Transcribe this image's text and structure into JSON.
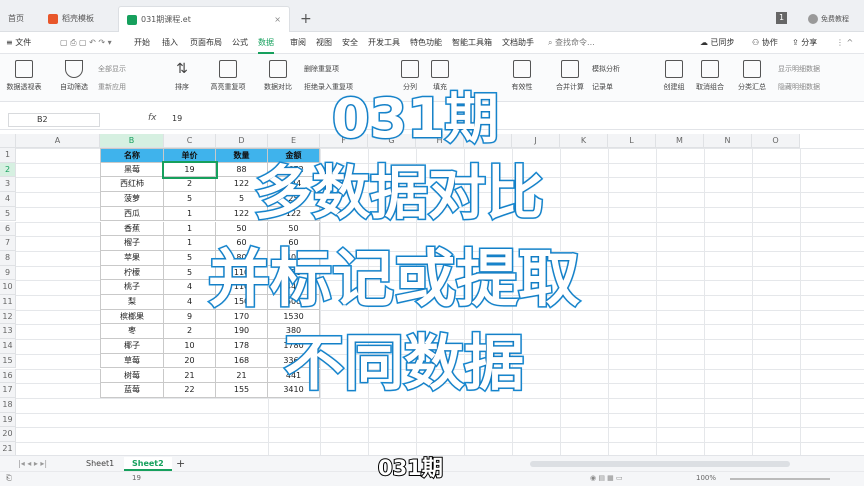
{
  "tabs": [
    {
      "label": "首页"
    },
    {
      "label": "稻壳模板"
    },
    {
      "label": "031期课程.et"
    }
  ],
  "new_tab": "+",
  "window_badge": "1",
  "user": "免费教程",
  "menu": [
    "文件",
    "开始",
    "插入",
    "页面布局",
    "公式",
    "数据",
    "审阅",
    "视图",
    "安全",
    "开发工具",
    "特色功能",
    "智能工具箱",
    "文档助手",
    "查找命令...",
    "已同步",
    "协作",
    "分享"
  ],
  "ribbon": {
    "buttons": [
      "数据透视表",
      "自动筛选",
      "排序",
      "高亮重复项",
      "数据对比",
      "分列",
      "填充",
      "有效性",
      "合并计算",
      "模拟分析",
      "记录单",
      "创建组",
      "取消组合",
      "分类汇总"
    ],
    "small": [
      "全部显示",
      "重新应用",
      "删除重复项",
      "拒绝录入重复项",
      "显示明细数据",
      "隐藏明细数据"
    ]
  },
  "formula_bar": {
    "cell_ref": "B2",
    "fx": "fx",
    "value": "19"
  },
  "columns": [
    "A",
    "B",
    "C",
    "D",
    "E",
    "F",
    "G",
    "H",
    "I",
    "J",
    "K",
    "L",
    "M",
    "N",
    "O"
  ],
  "table": {
    "headers": [
      "名称",
      "单价",
      "数量",
      "金额"
    ],
    "rows": [
      [
        "黑莓",
        "19",
        "88",
        "1672"
      ],
      [
        "西红柿",
        "2",
        "122",
        "244"
      ],
      [
        "菠萝",
        "5",
        "5",
        "25"
      ],
      [
        "西瓜",
        "1",
        "122",
        "122"
      ],
      [
        "香蕉",
        "1",
        "50",
        "50"
      ],
      [
        "榴子",
        "1",
        "60",
        "60"
      ],
      [
        "苹果",
        "5",
        "80",
        "400"
      ],
      [
        "柠檬",
        "5",
        "110",
        "550"
      ],
      [
        "桃子",
        "4",
        "110",
        "440"
      ],
      [
        "梨",
        "4",
        "150",
        "600"
      ],
      [
        "槟榔果",
        "9",
        "170",
        "1530"
      ],
      [
        "枣",
        "2",
        "190",
        "380"
      ],
      [
        "椰子",
        "10",
        "178",
        "1780"
      ],
      [
        "草莓",
        "20",
        "168",
        "3360"
      ],
      [
        "树莓",
        "21",
        "21",
        "441"
      ],
      [
        "蓝莓",
        "22",
        "155",
        "3410"
      ]
    ]
  },
  "row_numbers": [
    "1",
    "2",
    "3",
    "4",
    "5",
    "6",
    "7",
    "8",
    "9",
    "10",
    "11",
    "12",
    "13",
    "14",
    "15",
    "16",
    "17",
    "18",
    "19",
    "20",
    "21"
  ],
  "sheets": [
    {
      "label": "Sheet1"
    },
    {
      "label": "Sheet2"
    }
  ],
  "add_sheet": "+",
  "status": {
    "value": "19",
    "zoom": "100%"
  },
  "overlay": {
    "line1": "031期",
    "line2": "多数据对比",
    "line3": "并标记或提取",
    "line4": "不同数据",
    "subtitle": "031期"
  }
}
